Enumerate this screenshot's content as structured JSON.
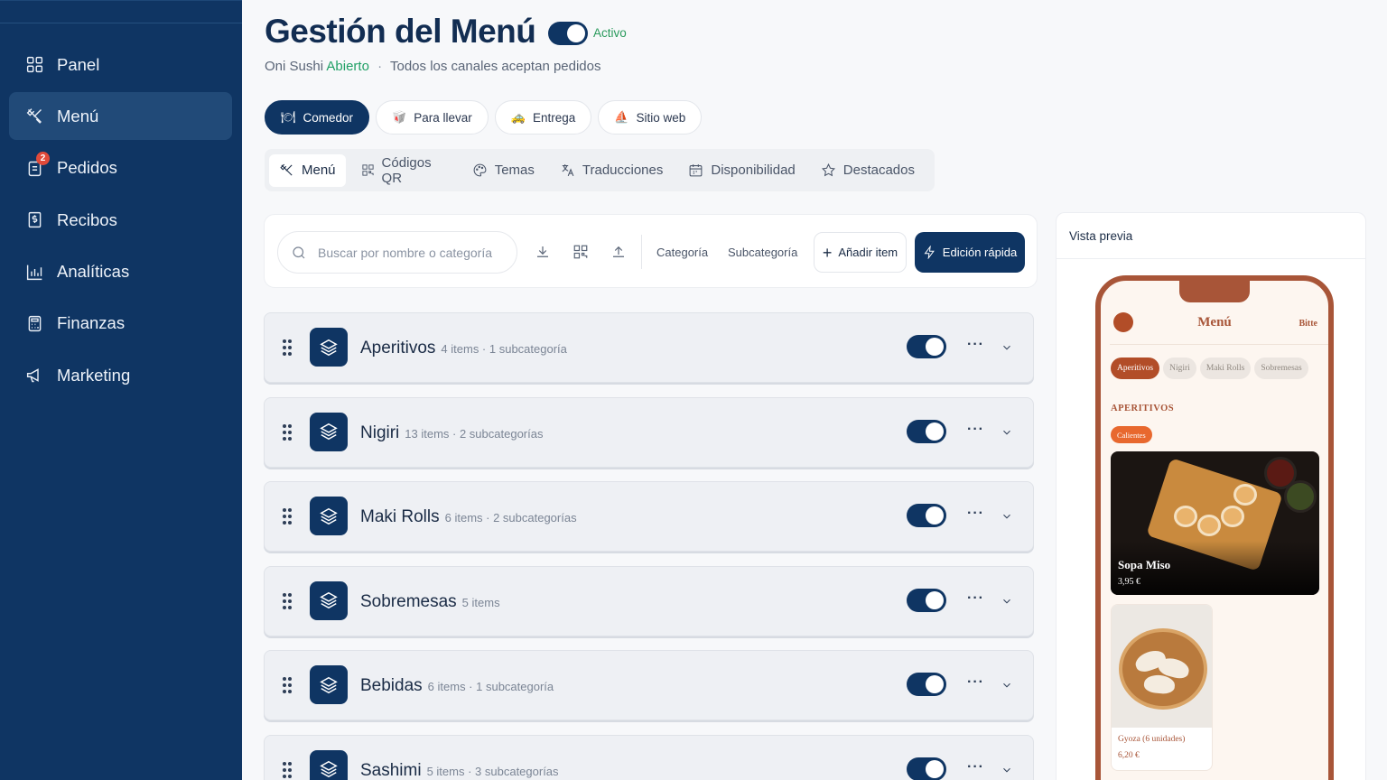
{
  "sidebar": {
    "items": [
      {
        "label": "Panel",
        "icon": "grid-icon"
      },
      {
        "label": "Menú",
        "icon": "utensils-icon",
        "active": true
      },
      {
        "label": "Pedidos",
        "icon": "orders-icon",
        "badge": "2"
      },
      {
        "label": "Recibos",
        "icon": "receipt-icon"
      },
      {
        "label": "Analíticas",
        "icon": "bar-chart-icon"
      },
      {
        "label": "Finanzas",
        "icon": "calculator-icon"
      },
      {
        "label": "Marketing",
        "icon": "megaphone-icon"
      }
    ]
  },
  "header": {
    "title": "Gestión del Menú",
    "status": "Activo",
    "restaurant": "Oni Sushi",
    "open_label": "Abierto",
    "separator": "·",
    "channels_note": "Todos los canales aceptan pedidos"
  },
  "channels": [
    {
      "label": "Comedor",
      "icon": "dining-icon",
      "active": true
    },
    {
      "label": "Para llevar",
      "icon": "takeaway-icon"
    },
    {
      "label": "Entrega",
      "icon": "delivery-icon"
    },
    {
      "label": "Sitio web",
      "icon": "website-icon"
    }
  ],
  "subtabs": [
    {
      "label": "Menú",
      "icon": "utensils-icon",
      "active": true
    },
    {
      "label": "Códigos QR",
      "icon": "qr-code-icon"
    },
    {
      "label": "Temas",
      "icon": "palette-icon"
    },
    {
      "label": "Traducciones",
      "icon": "translate-icon"
    },
    {
      "label": "Disponibilidad",
      "icon": "calendar-icon"
    },
    {
      "label": "Destacados",
      "icon": "star-icon"
    }
  ],
  "toolbar": {
    "search_placeholder": "Buscar por nombre o categoría",
    "category_label": "Categoría",
    "subcategory_label": "Subcategoría",
    "add_label": "Añadir item",
    "quick_edit_label": "Edición rápida"
  },
  "categories": [
    {
      "name": "Aperitivos",
      "meta": "4 items · 1 subcategoría",
      "enabled": true
    },
    {
      "name": "Nigiri",
      "meta": "13 items · 2 subcategorías",
      "enabled": true
    },
    {
      "name": "Maki Rolls",
      "meta": "6 items · 2 subcategorías",
      "enabled": true
    },
    {
      "name": "Sobremesas",
      "meta": "5 items",
      "enabled": true
    },
    {
      "name": "Bebidas",
      "meta": "6 items · 1 subcategoría",
      "enabled": true
    },
    {
      "name": "Sashimi",
      "meta": "5 items · 3 subcategorías",
      "enabled": true
    }
  ],
  "row_more": "···",
  "preview": {
    "title": "Vista previa",
    "phone": {
      "title": "Menú",
      "brand": "Bitte",
      "chips": [
        "Aperitivos",
        "Nigiri",
        "Maki Rolls",
        "Sobremesas"
      ],
      "section": "APERITIVOS",
      "tag": "Calientes",
      "items": [
        {
          "name": "Sopa Miso",
          "price": "3,95 €"
        },
        {
          "name": "Gyoza (6 unidades)",
          "price": "6,20 €"
        }
      ]
    }
  },
  "colors": {
    "navy": "#0f3563",
    "open_green": "#21a066",
    "preview_accent": "#a85538",
    "tag_orange": "#e8682e",
    "badge_red": "#e04a3a"
  }
}
